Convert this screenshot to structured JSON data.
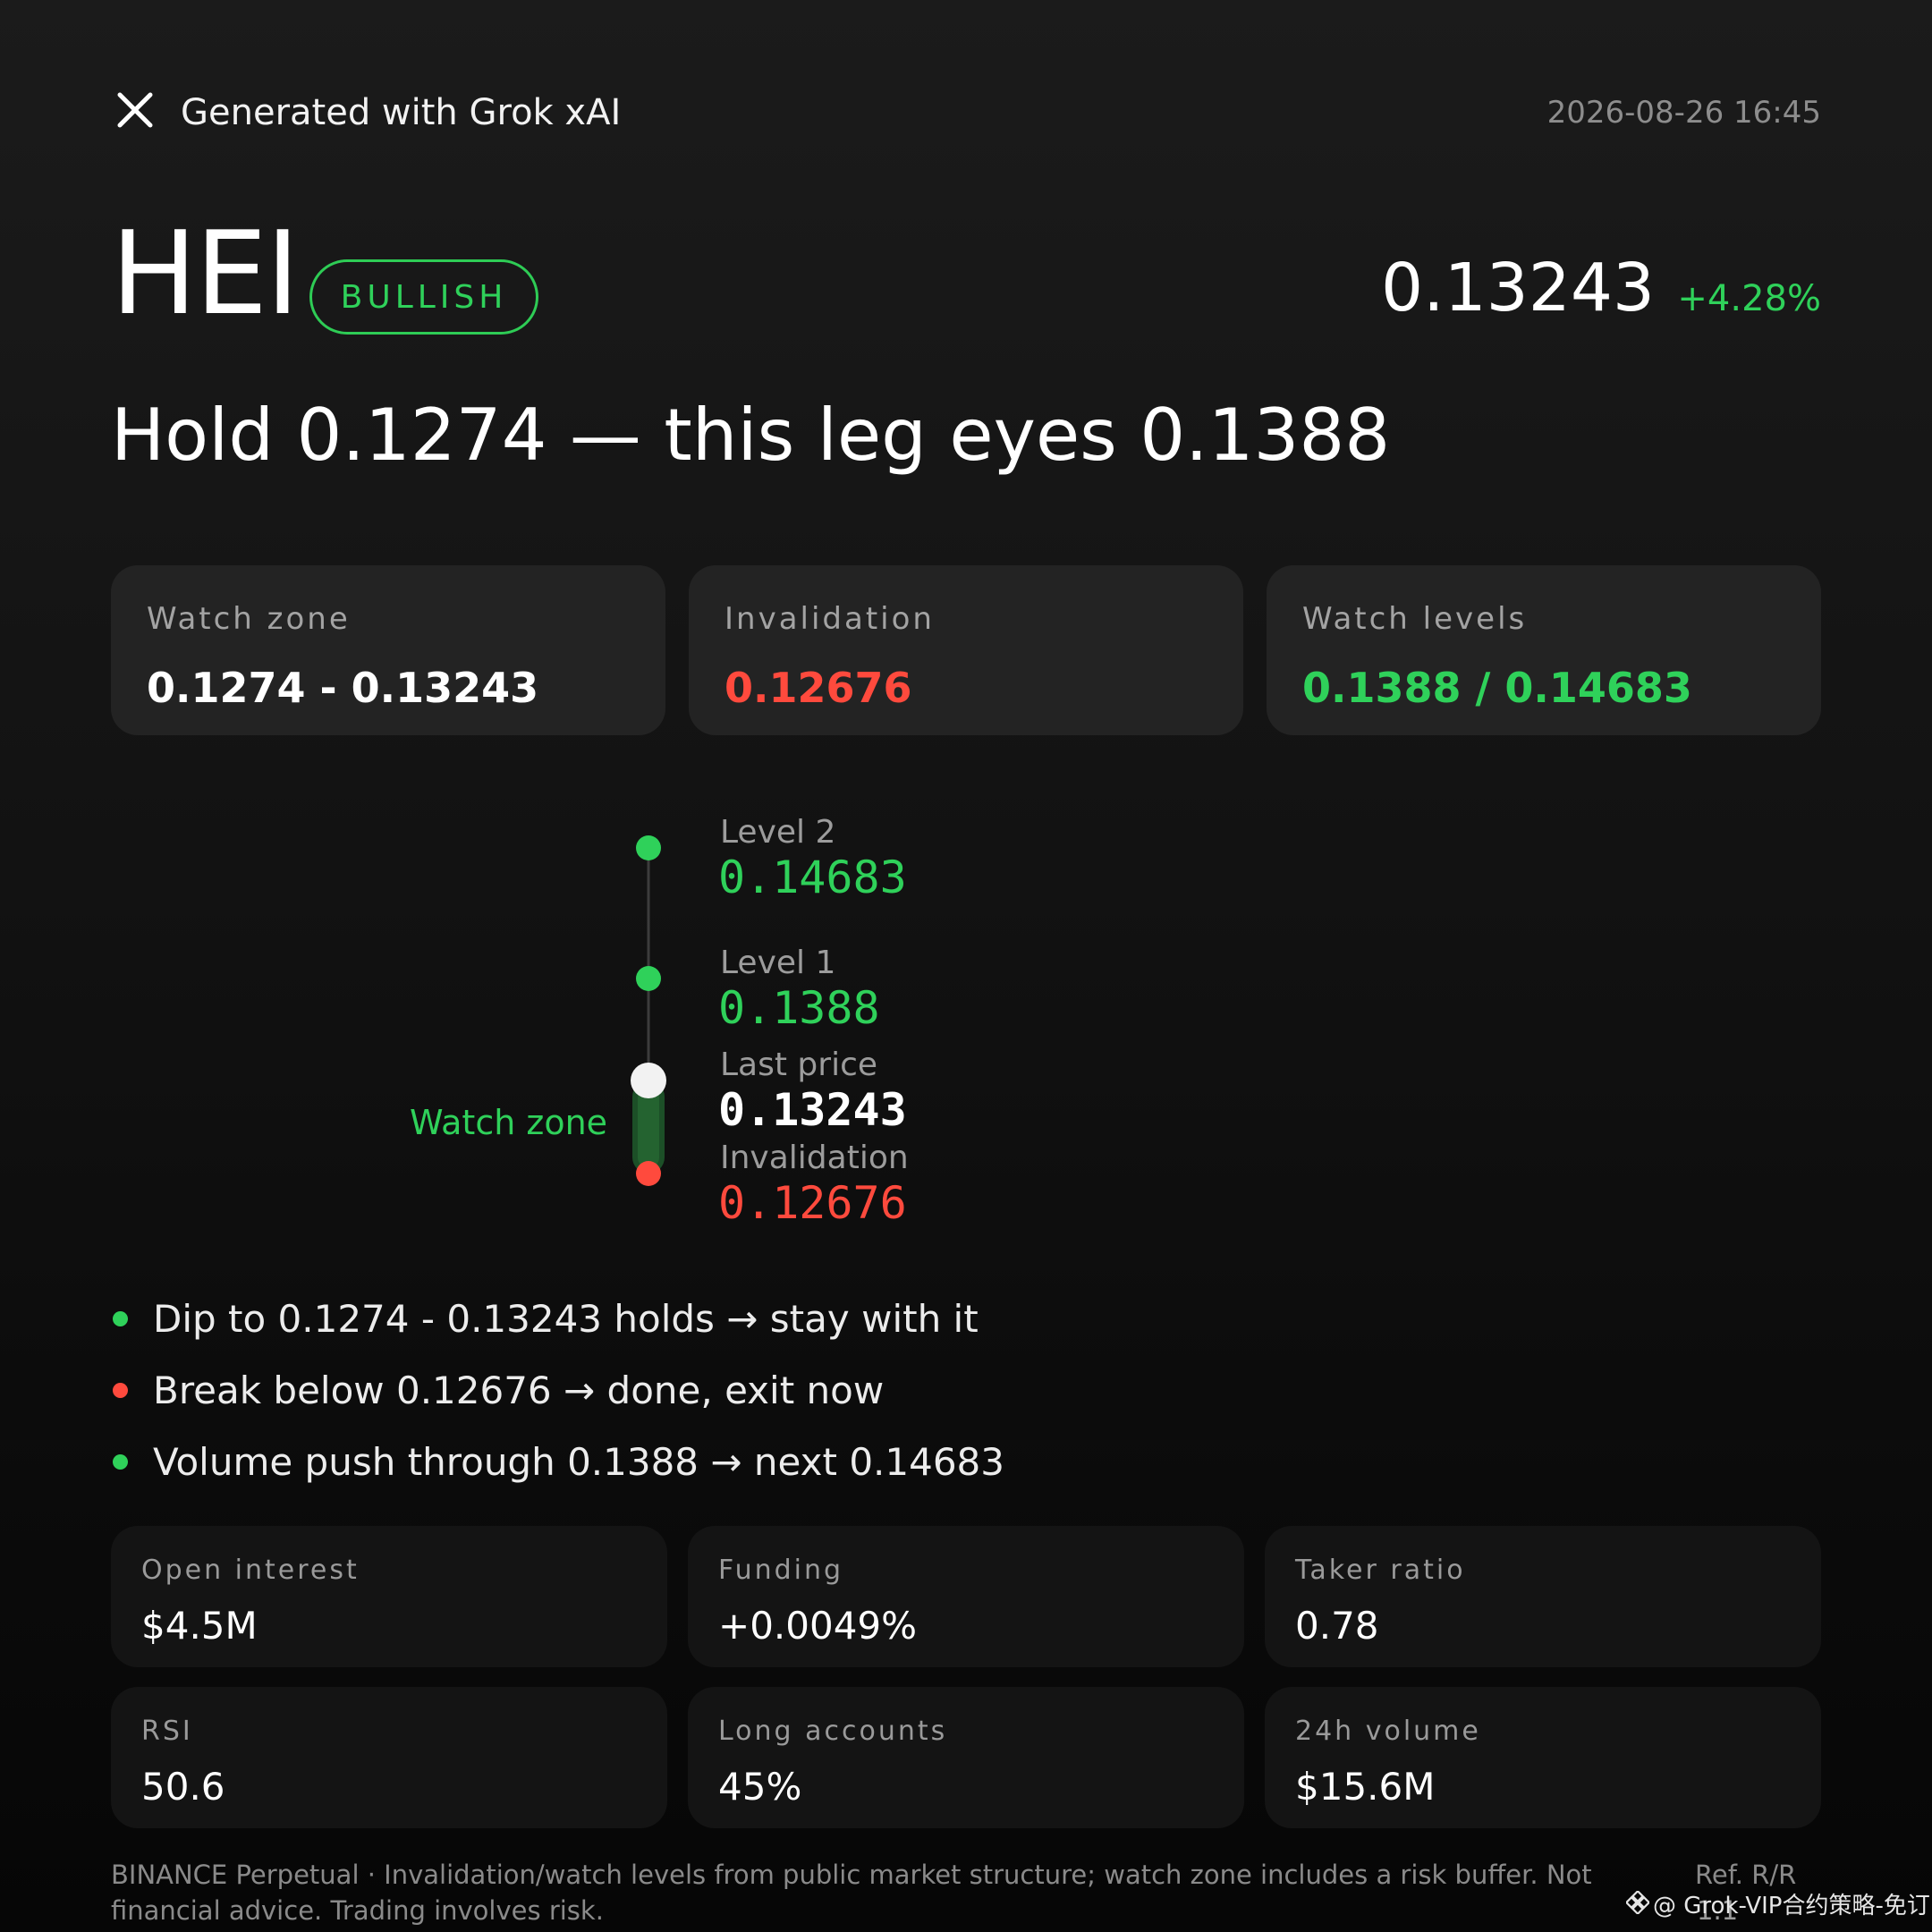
{
  "header": {
    "title": "Generated with Grok xAI",
    "timestamp": "2026-08-26 16:45"
  },
  "asset": {
    "ticker": "HEI",
    "sentiment": "BULLISH",
    "last_price": "0.13243",
    "change": "+4.28%"
  },
  "headline": "Hold 0.1274 — this leg eyes 0.1388",
  "summary": [
    {
      "label": "Watch zone",
      "value": "0.1274 - 0.13243",
      "color": "#ffffff"
    },
    {
      "label": "Invalidation",
      "value": "0.12676",
      "color": "#ff4a3d"
    },
    {
      "label": "Watch levels",
      "value": "0.1388 / 0.14683",
      "color": "#2fd15a"
    }
  ],
  "ladder": {
    "watch_zone_label": "Watch zone",
    "levels": [
      {
        "label": "Level 2",
        "value": "0.14683",
        "color": "#2fd15a"
      },
      {
        "label": "Level 1",
        "value": "0.1388",
        "color": "#2fd15a"
      },
      {
        "label": "Last price",
        "value": "0.13243",
        "color": "#ffffff"
      },
      {
        "label": "Invalidation",
        "value": "0.12676",
        "color": "#ff4a3d"
      }
    ]
  },
  "scenarios": [
    {
      "text": "Dip to 0.1274 - 0.13243 holds → stay with it",
      "color": "#2fd15a"
    },
    {
      "text": "Break below 0.12676 → done, exit now",
      "color": "#ff4a3d"
    },
    {
      "text": "Volume push through 0.1388 → next 0.14683",
      "color": "#2fd15a"
    }
  ],
  "metrics": [
    {
      "label": "Open interest",
      "value": "$4.5M"
    },
    {
      "label": "Funding",
      "value": "+0.0049%"
    },
    {
      "label": "Taker ratio",
      "value": "0.78"
    },
    {
      "label": "RSI",
      "value": "50.6"
    },
    {
      "label": "Long accounts",
      "value": "45%"
    },
    {
      "label": "24h volume",
      "value": "$15.6M"
    }
  ],
  "footer": {
    "disclaimer": "BINANCE Perpetual · Invalidation/watch levels from public market structure; watch zone includes a risk buffer. Not financial advice. Trading involves risk.",
    "ref_label": "Ref. R/R",
    "rr_value": "1.1",
    "watermark": "@ Grok-VIP合约策略-免订阅",
    "watermark_icon": "binance-logo-icon"
  },
  "colors": {
    "bullish": "#2fd15a",
    "bearish": "#ff4a3d",
    "card_bg": "#232323",
    "metric_bg": "#141414"
  }
}
